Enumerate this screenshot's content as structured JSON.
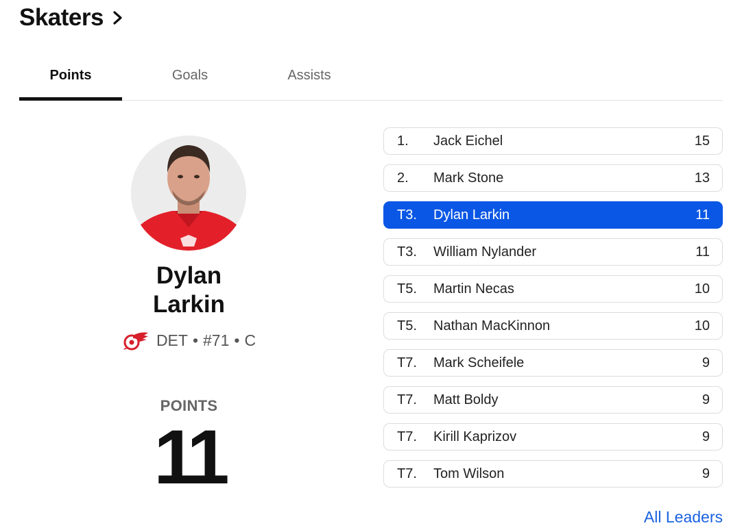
{
  "header": {
    "title": "Skaters"
  },
  "tabs": [
    {
      "label": "Points"
    },
    {
      "label": "Goals"
    },
    {
      "label": "Assists"
    }
  ],
  "featured": {
    "first_name": "Dylan",
    "last_name": "Larkin",
    "team": "DET",
    "number": "#71",
    "position": "C",
    "separator": "•",
    "stat_label": "POINTS",
    "stat_value": "11"
  },
  "leaders": [
    {
      "rank": "1.",
      "name": "Jack Eichel",
      "value": "15"
    },
    {
      "rank": "2.",
      "name": "Mark Stone",
      "value": "13"
    },
    {
      "rank": "T3.",
      "name": "Dylan Larkin",
      "value": "11"
    },
    {
      "rank": "T3.",
      "name": "William Nylander",
      "value": "11"
    },
    {
      "rank": "T5.",
      "name": "Martin Necas",
      "value": "10"
    },
    {
      "rank": "T5.",
      "name": "Nathan MacKinnon",
      "value": "10"
    },
    {
      "rank": "T7.",
      "name": "Mark Scheifele",
      "value": "9"
    },
    {
      "rank": "T7.",
      "name": "Matt Boldy",
      "value": "9"
    },
    {
      "rank": "T7.",
      "name": "Kirill Kaprizov",
      "value": "9"
    },
    {
      "rank": "T7.",
      "name": "Tom Wilson",
      "value": "9"
    }
  ],
  "all_leaders_link": "All Leaders",
  "icons": {
    "chevron": "chevron-right-icon",
    "team_logo": "red-wings-logo"
  },
  "colors": {
    "highlight": "#0a57e5",
    "link": "#1a62e0",
    "jersey": "#e3202a"
  }
}
